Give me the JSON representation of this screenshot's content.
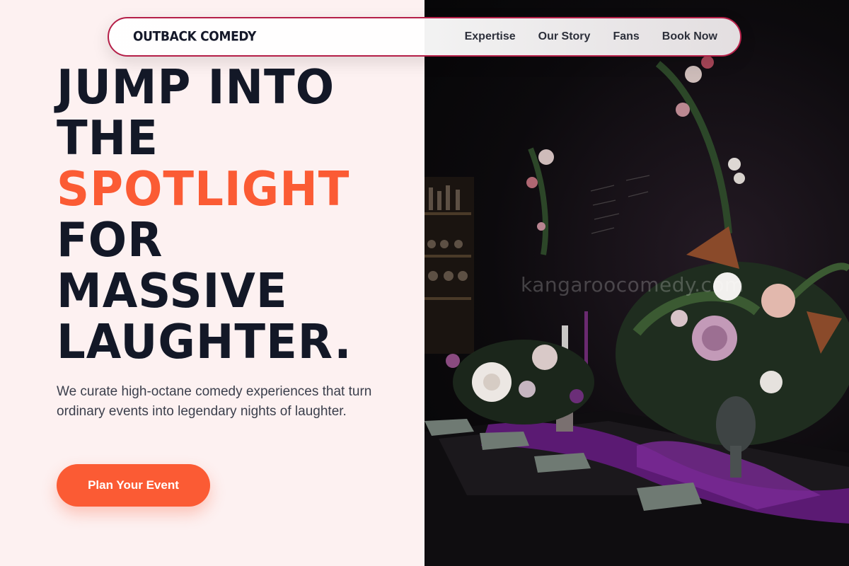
{
  "nav": {
    "brand": "OUTBACK COMEDY",
    "links": [
      "Expertise",
      "Our Story",
      "Fans",
      "Book Now"
    ]
  },
  "hero": {
    "headline": {
      "line1": "JUMP INTO",
      "line2": "THE",
      "line3_accent": "SPOTLIGHT",
      "line4": "FOR",
      "line5": "MASSIVE",
      "line6": "LAUGHTER."
    },
    "subtext": "We curate high-octane comedy experiences that turn ordinary events into legendary nights of laughter.",
    "cta_label": "Plan Your Event"
  },
  "photo": {
    "watermark": "kangaroocomedy.com"
  },
  "colors": {
    "accent": "#fb5b34",
    "nav_border": "#b51f48",
    "headline": "#131827",
    "background": "#fdf1f1"
  }
}
